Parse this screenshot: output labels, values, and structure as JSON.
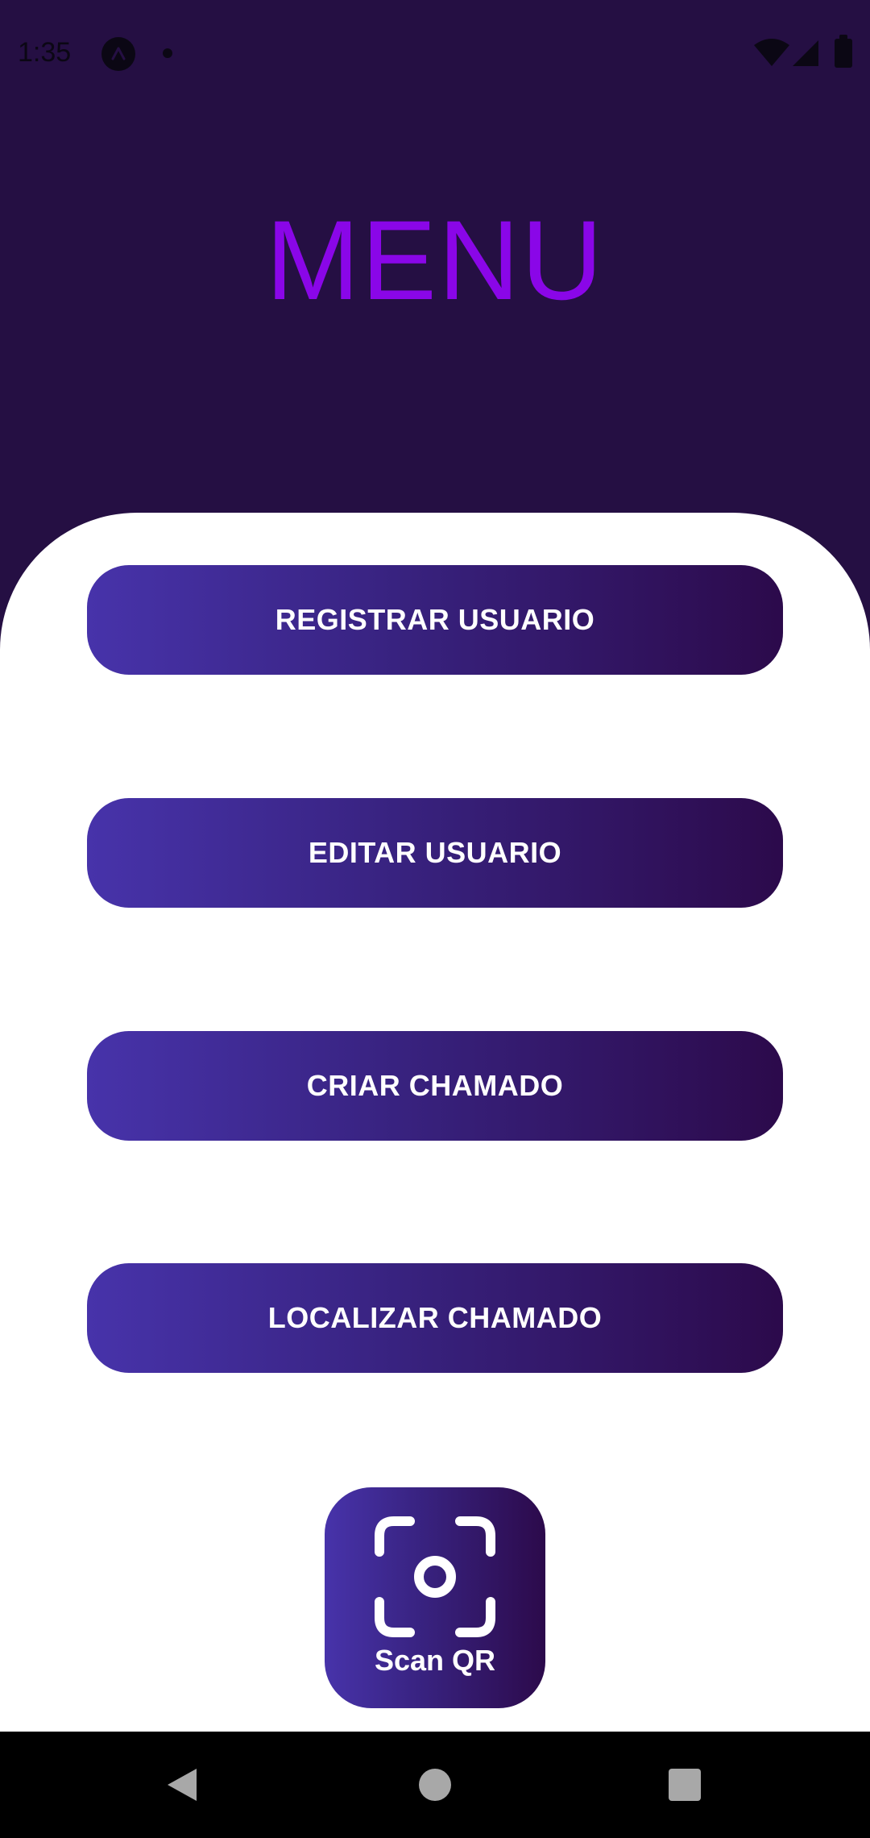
{
  "status_bar": {
    "time": "1:35"
  },
  "header": {
    "title": "MENU"
  },
  "menu": {
    "buttons": [
      {
        "label": "REGISTRAR USUARIO"
      },
      {
        "label": "EDITAR USUARIO"
      },
      {
        "label": "CRIAR CHAMADO"
      },
      {
        "label": "LOCALIZAR CHAMADO"
      }
    ],
    "scan_button": {
      "label": "Scan QR",
      "icon": "qr-scan-icon"
    }
  },
  "colors": {
    "header_background": "#250f43",
    "title": "#8a06e8",
    "button_gradient_start": "#4733aa",
    "button_gradient_end": "#2c0a4b",
    "button_text": "#ffffff",
    "card_background": "#ffffff"
  },
  "nav_bar": {
    "icons": [
      "back-icon",
      "home-icon",
      "recents-icon"
    ]
  }
}
